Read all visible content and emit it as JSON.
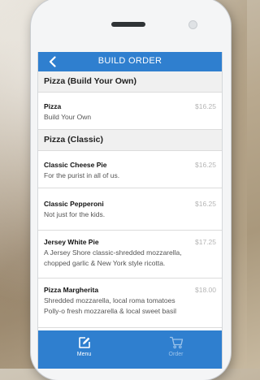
{
  "header": {
    "title": "BUILD ORDER"
  },
  "sections": [
    {
      "title": "Pizza (Build Your Own)",
      "items": [
        {
          "name": "Pizza",
          "price": "$16.25",
          "description": "Build Your Own"
        }
      ]
    },
    {
      "title": "Pizza (Classic)",
      "items": [
        {
          "name": "Classic Cheese Pie",
          "price": "$16.25",
          "description": "For the purist in all of us."
        },
        {
          "name": "Classic Pepperoni",
          "price": "$16.25",
          "description": "Not just for the kids."
        },
        {
          "name": "Jersey White Pie",
          "price": "$17.25",
          "description_lines": [
            "A Jersey Shore classic-shredded mozzarella,",
            "chopped garlic & New York style ricotta."
          ]
        },
        {
          "name": "Pizza Margherita",
          "price": "$18.00",
          "description_lines": [
            "Shredded mozzarella, local roma tomatoes",
            "Polly-o fresh mozzarella & local sweet basil"
          ]
        }
      ]
    }
  ],
  "tabbar": {
    "tabs": [
      {
        "label": "Menu",
        "icon": "edit-icon",
        "active": true
      },
      {
        "label": "Order",
        "icon": "cart-icon",
        "active": false
      }
    ]
  },
  "colors": {
    "accent": "#2f7fcf",
    "section_bg": "#f0f0f0",
    "price_text": "#b5b5b5",
    "inactive_tab": "#9cc3ea"
  }
}
